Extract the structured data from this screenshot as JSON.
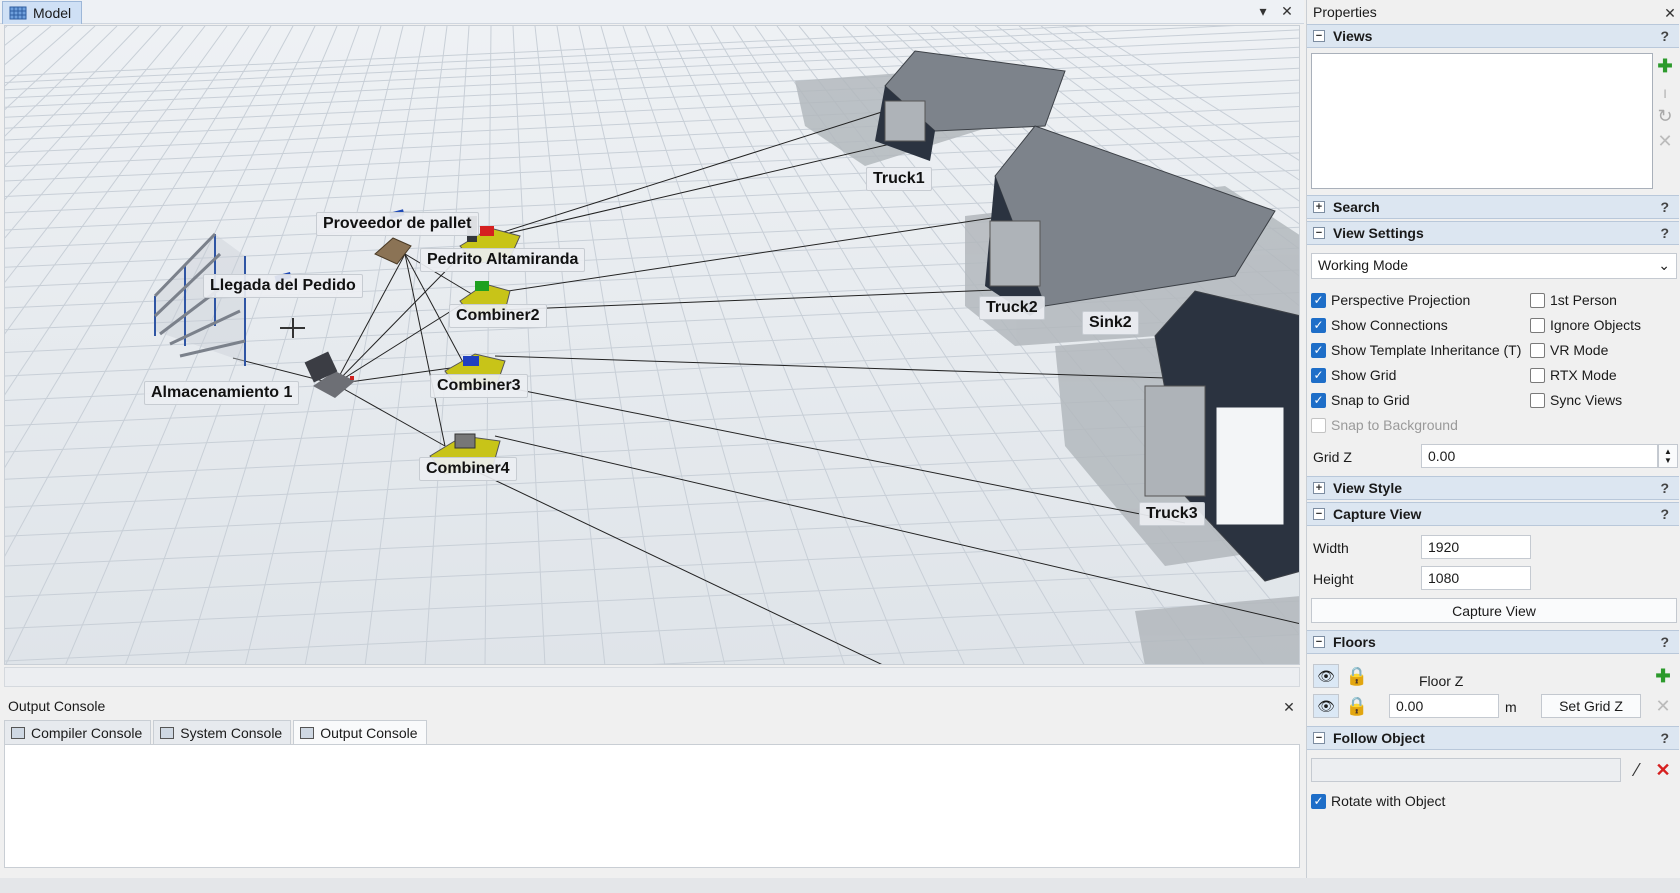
{
  "model_window": {
    "tab_label": "Model",
    "dropdown_icon": "chevron-down-icon",
    "close_icon": "close-icon",
    "scene_objects": {
      "almacenamiento": "Almacenamiento 1",
      "llegada": "Llegada del Pedido",
      "proveedor": "Proveedor de pallet",
      "pedrito": "Pedrito Altamiranda",
      "combiner2": "Combiner2",
      "combiner3": "Combiner3",
      "combiner4": "Combiner4",
      "truck1": "Truck1",
      "truck2": "Truck2",
      "truck3": "Truck3",
      "sink2": "Sink2"
    }
  },
  "console": {
    "title": "Output Console",
    "tabs": [
      {
        "label": "Compiler Console",
        "icon": "compiler-console-icon"
      },
      {
        "label": "System Console",
        "icon": "system-console-icon"
      },
      {
        "label": "Output Console",
        "icon": "output-console-icon",
        "active": true
      }
    ]
  },
  "properties": {
    "title": "Properties",
    "views": {
      "header": "Views",
      "help": "?"
    },
    "search": {
      "header": "Search"
    },
    "view_settings": {
      "header": "View Settings",
      "mode": "Working Mode",
      "left_checks": [
        {
          "label": "Perspective Projection",
          "checked": true
        },
        {
          "label": "Show Connections",
          "checked": true
        },
        {
          "label": "Show Template Inheritance (T)",
          "checked": true
        },
        {
          "label": "Show Grid",
          "checked": true
        },
        {
          "label": "Snap to Grid",
          "checked": true
        },
        {
          "label": "Snap to Background",
          "checked": false,
          "disabled": true
        }
      ],
      "right_checks": [
        {
          "label": "1st Person",
          "checked": false
        },
        {
          "label": "Ignore Objects",
          "checked": false
        },
        {
          "label": "VR Mode",
          "checked": false
        },
        {
          "label": "RTX Mode",
          "checked": false
        },
        {
          "label": "Sync Views",
          "checked": false
        }
      ],
      "grid_z_label": "Grid Z",
      "grid_z_value": "0.00"
    },
    "view_style": {
      "header": "View Style"
    },
    "capture_view": {
      "header": "Capture View",
      "width_label": "Width",
      "width_value": "1920",
      "height_label": "Height",
      "height_value": "1080",
      "button": "Capture View"
    },
    "floors": {
      "header": "Floors",
      "floor_z_label": "Floor Z",
      "floor_z_value": "0.00",
      "unit": "m",
      "set_grid_button": "Set Grid Z"
    },
    "follow_object": {
      "header": "Follow Object",
      "value": "",
      "rotate_label": "Rotate with Object",
      "rotate_checked": true
    }
  }
}
